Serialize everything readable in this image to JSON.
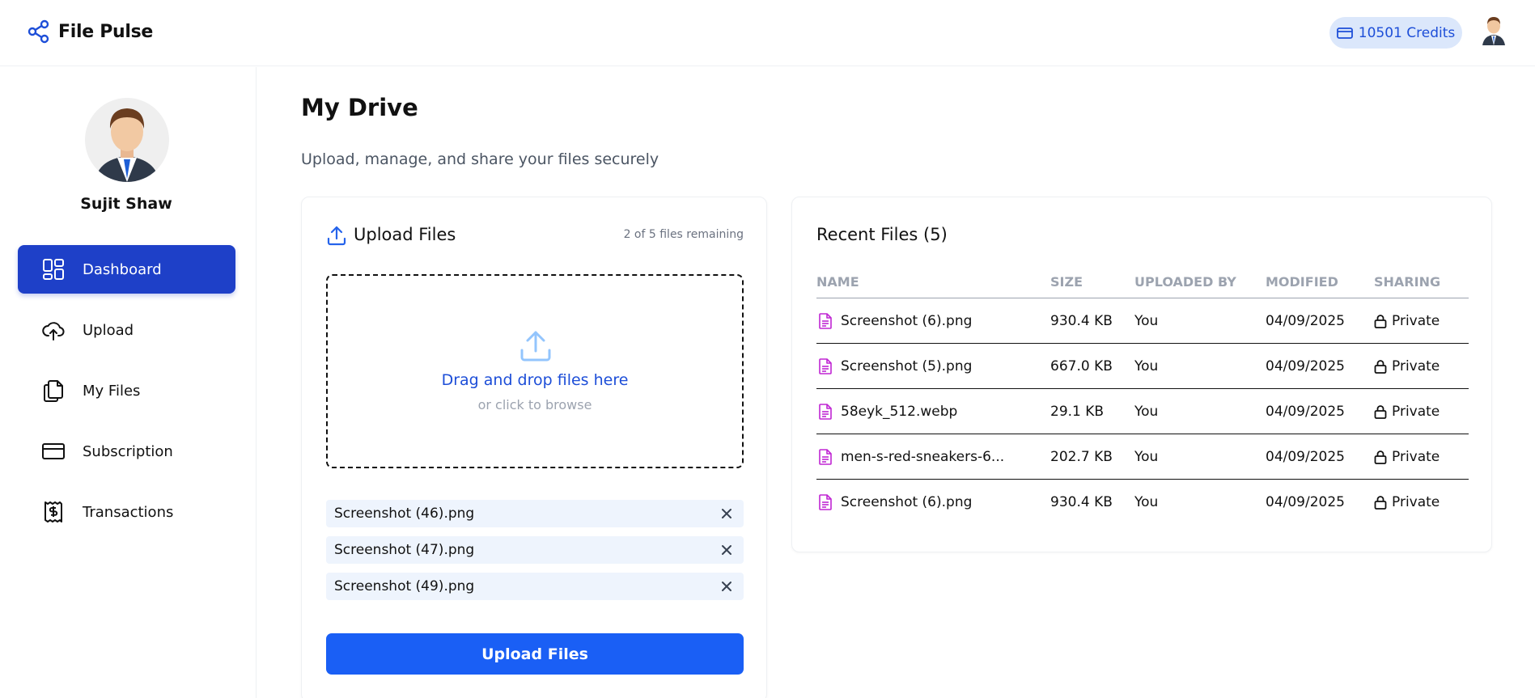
{
  "app": {
    "name": "File Pulse"
  },
  "header": {
    "credits_label": "10501 Credits"
  },
  "sidebar": {
    "user_name": "Sujit Shaw",
    "items": [
      {
        "label": "Dashboard",
        "icon": "dashboard-icon",
        "active": true
      },
      {
        "label": "Upload",
        "icon": "cloud-upload-icon",
        "active": false
      },
      {
        "label": "My Files",
        "icon": "files-icon",
        "active": false
      },
      {
        "label": "Subscription",
        "icon": "credit-card-icon",
        "active": false
      },
      {
        "label": "Transactions",
        "icon": "receipt-icon",
        "active": false
      }
    ]
  },
  "main": {
    "title": "My Drive",
    "subtitle": "Upload, manage, and share your files securely"
  },
  "upload": {
    "title": "Upload Files",
    "remaining": "2 of 5 files remaining",
    "drop_main": "Drag and drop files here",
    "drop_sub": "or click to browse",
    "pending_files": [
      "Screenshot (46).png",
      "Screenshot (47).png",
      "Screenshot (49).png"
    ],
    "button_label": "Upload Files"
  },
  "recent": {
    "title": "Recent Files (5)",
    "columns": [
      "Name",
      "Size",
      "Uploaded By",
      "Modified",
      "Sharing"
    ],
    "rows": [
      {
        "name": "Screenshot (6).png",
        "size": "930.4 KB",
        "uploaded_by": "You",
        "modified": "04/09/2025",
        "sharing": "Private"
      },
      {
        "name": "Screenshot (5).png",
        "size": "667.0 KB",
        "uploaded_by": "You",
        "modified": "04/09/2025",
        "sharing": "Private"
      },
      {
        "name": "58eyk_512.webp",
        "size": "29.1 KB",
        "uploaded_by": "You",
        "modified": "04/09/2025",
        "sharing": "Private"
      },
      {
        "name": "men-s-red-sneakers-6...",
        "size": "202.7 KB",
        "uploaded_by": "You",
        "modified": "04/09/2025",
        "sharing": "Private"
      },
      {
        "name": "Screenshot (6).png",
        "size": "930.4 KB",
        "uploaded_by": "You",
        "modified": "04/09/2025",
        "sharing": "Private"
      }
    ]
  },
  "colors": {
    "accent": "#1a5ff5",
    "active_nav": "#1e40c8",
    "credits_bg": "#dbe7fb",
    "file_icon": "#c026d3"
  }
}
